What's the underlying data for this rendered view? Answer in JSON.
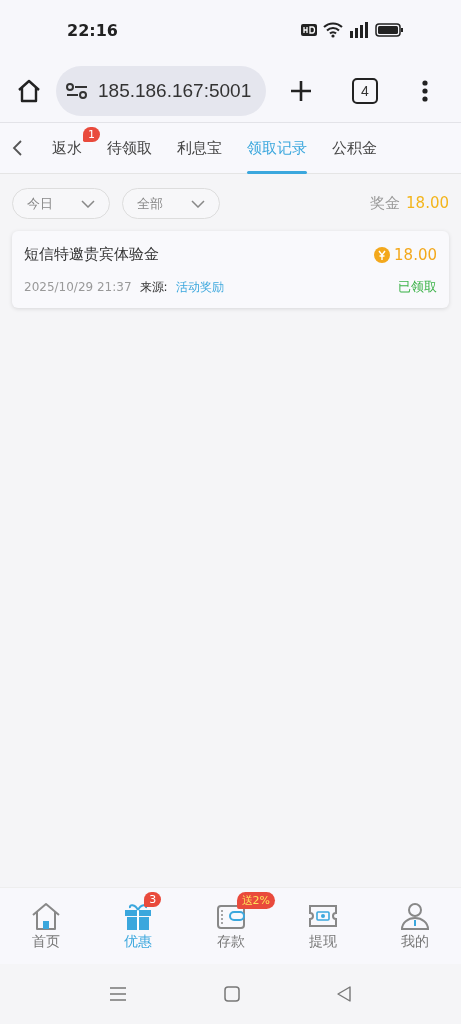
{
  "status_bar": {
    "time": "22:16"
  },
  "browser": {
    "url": "185.186.167:5001",
    "tab_count": "4"
  },
  "tabs": [
    {
      "label": "返水",
      "selected": false,
      "badge": "1"
    },
    {
      "label": "待领取",
      "selected": false
    },
    {
      "label": "利息宝",
      "selected": false
    },
    {
      "label": "领取记录",
      "selected": true
    },
    {
      "label": "公积金",
      "selected": false
    }
  ],
  "filters": [
    {
      "label": "今日"
    },
    {
      "label": "全部"
    }
  ],
  "total": {
    "label": "奖金",
    "value": "18.00"
  },
  "records": [
    {
      "title": "短信特邀贵宾体验金",
      "amount": "18.00",
      "time": "2025/10/29 21:37",
      "source_label": "来源:",
      "source": "活动奖励",
      "status": "已领取"
    }
  ],
  "bottom_nav": [
    {
      "kind": "home",
      "label": "首页",
      "selected": false
    },
    {
      "kind": "gift",
      "label": "优惠",
      "selected": true,
      "badge": "3"
    },
    {
      "kind": "wallet",
      "label": "存款",
      "selected": false,
      "badge": "送2%"
    },
    {
      "kind": "ticket",
      "label": "提现",
      "selected": false
    },
    {
      "kind": "person",
      "label": "我的",
      "selected": false
    }
  ]
}
